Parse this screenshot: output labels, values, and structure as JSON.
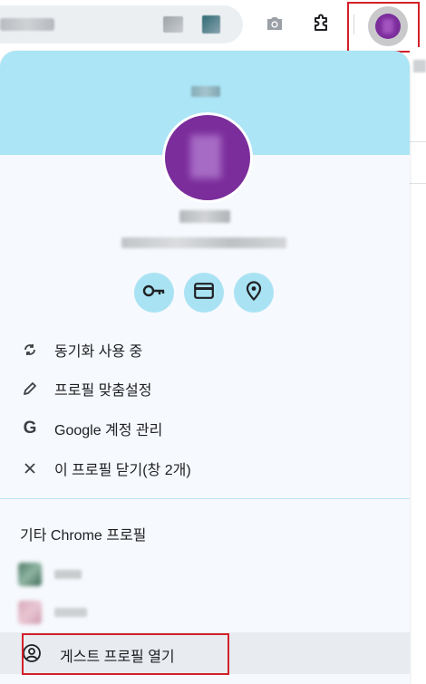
{
  "toolbar": {
    "icons": [
      "camera-icon",
      "extensions-puzzle-icon"
    ],
    "avatar_color": "#7b2d9b"
  },
  "profile_panel": {
    "banner_color": "#abe5f6",
    "avatar_color": "#7b2d9b",
    "quick_actions": [
      "password-key-icon",
      "payment-card-icon",
      "location-pin-icon"
    ],
    "menu": [
      {
        "icon": "sync-icon",
        "label": "동기화 사용 중"
      },
      {
        "icon": "pencil-icon",
        "label": "프로필 맞춤설정"
      },
      {
        "icon": "google-g-icon",
        "label": "Google 계정 관리"
      },
      {
        "icon": "close-icon",
        "label": "이 프로필 닫기(창 2개)"
      }
    ],
    "other_profiles_title": "기타 Chrome 프로필",
    "guest_label": "게스트 프로필 열기"
  },
  "colors": {
    "highlight": "#d3202a",
    "accent_circle": "#a9e3f3"
  }
}
